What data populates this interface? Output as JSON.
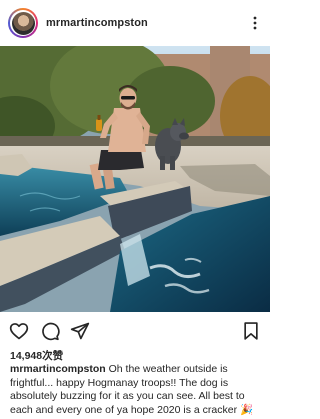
{
  "post": {
    "username": "mrmartincompston",
    "likes_text": "14,948次赞",
    "caption_user": "mrmartincompston",
    "caption_text": "Oh the weather outside is frightful... happy Hogmanay troops!! The dog is absolutely buzzing for it as you can see. All best to each and every one of ya hope 2020 is a cracker 🎉"
  },
  "icons": {
    "more": "more-vertical-icon",
    "like": "heart-icon",
    "comment": "comment-bubble-icon",
    "share": "paper-plane-icon",
    "save": "bookmark-icon"
  },
  "colors": {
    "text": "#262626",
    "background": "#ffffff"
  }
}
